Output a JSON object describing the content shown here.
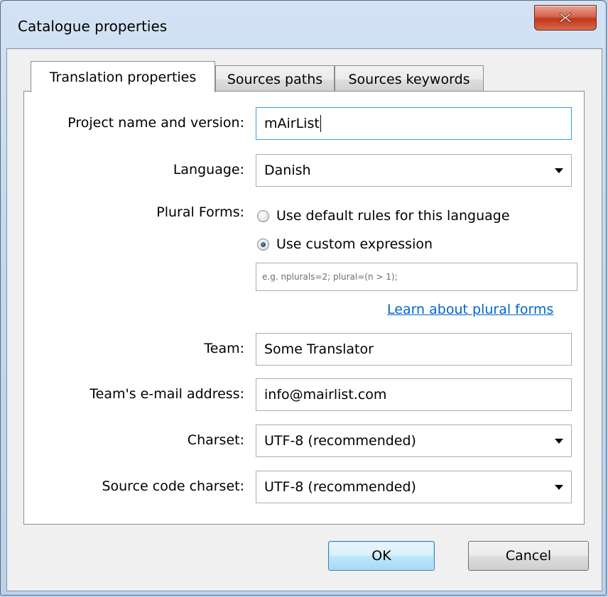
{
  "window": {
    "title": "Catalogue properties",
    "close_icon": "close-x-icon"
  },
  "tabs": [
    {
      "label": "Translation properties",
      "active": true
    },
    {
      "label": "Sources paths",
      "active": false
    },
    {
      "label": "Sources keywords",
      "active": false
    }
  ],
  "form": {
    "project_label": "Project name and version:",
    "project_value": "mAirList",
    "language_label": "Language:",
    "language_value": "Danish",
    "plural_label": "Plural Forms:",
    "plural_default_label": "Use default rules for this language",
    "plural_custom_label": "Use custom expression",
    "plural_selected": "custom",
    "plural_expression_placeholder": "e.g. nplurals=2; plural=(n > 1);",
    "plural_link": "Learn about plural forms",
    "team_label": "Team:",
    "team_value": "Some Translator",
    "email_label": "Team's e-mail address:",
    "email_value": "info@mairlist.com",
    "charset_label": "Charset:",
    "charset_value": "UTF-8 (recommended)",
    "source_charset_label": "Source code charset:",
    "source_charset_value": "UTF-8 (recommended)"
  },
  "buttons": {
    "ok": "OK",
    "cancel": "Cancel"
  },
  "colors": {
    "link": "#0066cc",
    "focus_border": "#3399ff",
    "close_button": "#c2361c"
  }
}
